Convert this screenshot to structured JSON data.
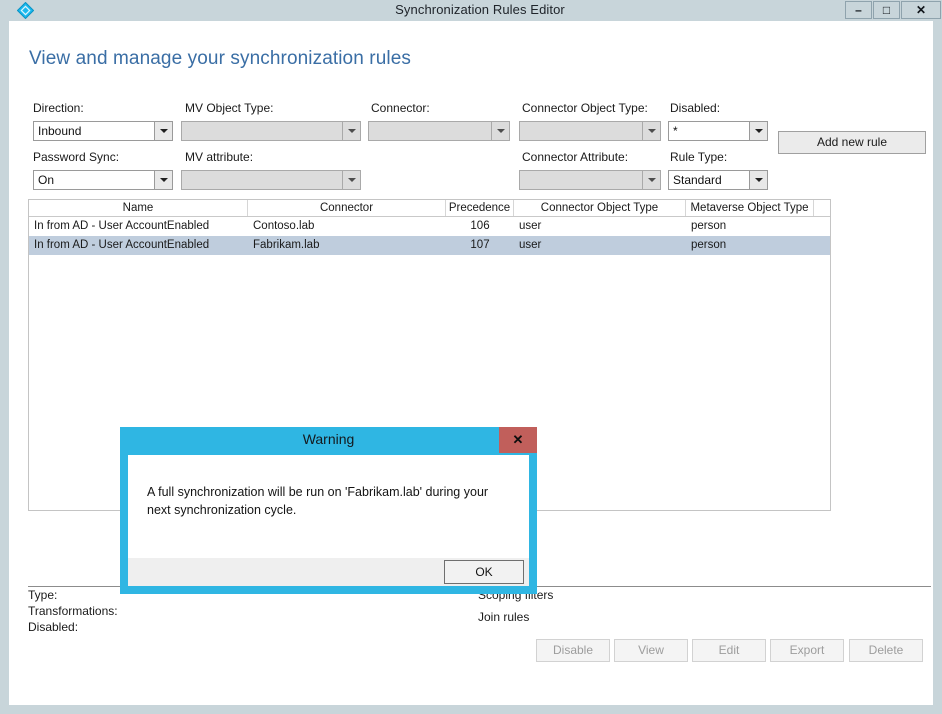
{
  "window": {
    "title": "Synchronization Rules Editor",
    "app_icon": "sync-diamond-icon",
    "minimize_label": "–",
    "maximize_label": "□",
    "close_label": "✕"
  },
  "page": {
    "heading": "View and manage your synchronization rules"
  },
  "filters": [
    {
      "label": "Direction:",
      "value": "Inbound",
      "disabled": false,
      "name": "direction"
    },
    {
      "label": "MV Object Type:",
      "value": "",
      "disabled": true,
      "name": "mv-object-type"
    },
    {
      "label": "Connector:",
      "value": "",
      "disabled": true,
      "name": "connector"
    },
    {
      "label": "Connector Object Type:",
      "value": "",
      "disabled": true,
      "name": "connector-object-type"
    },
    {
      "label": "Disabled:",
      "value": "*",
      "disabled": false,
      "name": "disabled"
    },
    {
      "label": "Password Sync:",
      "value": "On",
      "disabled": false,
      "name": "password-sync"
    },
    {
      "label": "MV attribute:",
      "value": "",
      "disabled": true,
      "name": "mv-attribute"
    },
    {
      "label": "Connector Attribute:",
      "value": "",
      "disabled": true,
      "name": "connector-attribute"
    },
    {
      "label": "Rule Type:",
      "value": "Standard",
      "disabled": false,
      "name": "rule-type"
    }
  ],
  "toolbar": {
    "add_new_rule_label": "Add new rule"
  },
  "table": {
    "columns": [
      "Name",
      "Connector",
      "Precedence",
      "Connector Object Type",
      "Metaverse Object Type"
    ],
    "rows": [
      {
        "name": "In from AD - User AccountEnabled",
        "connector": "Contoso.lab",
        "precedence": "106",
        "connector_object_type": "user",
        "metaverse_object_type": "person",
        "selected": false
      },
      {
        "name": "In from AD - User AccountEnabled",
        "connector": "Fabrikam.lab",
        "precedence": "107",
        "connector_object_type": "user",
        "metaverse_object_type": "person",
        "selected": true
      }
    ]
  },
  "details": {
    "type_label": "Type:",
    "transformations_label": "Transformations:",
    "disabled_label": "Disabled:",
    "scoping_filters_label": "Scoping filters",
    "join_rules_label": "Join rules"
  },
  "actions": [
    {
      "label": "Disable",
      "name": "disable-button"
    },
    {
      "label": "View",
      "name": "view-button"
    },
    {
      "label": "Edit",
      "name": "edit-button"
    },
    {
      "label": "Export",
      "name": "export-button"
    },
    {
      "label": "Delete",
      "name": "delete-button"
    }
  ],
  "dialog": {
    "title": "Warning",
    "close_label": "✕",
    "message": "A full synchronization will be run on 'Fabrikam.lab' during your next synchronization cycle.",
    "ok_label": "OK"
  },
  "colors": {
    "titlebar": "#c8d5da",
    "heading": "#3a6ea5",
    "dialog_accent": "#2fb6e3",
    "dialog_close": "#c15f5b",
    "row_selected": "#bfcddd"
  }
}
